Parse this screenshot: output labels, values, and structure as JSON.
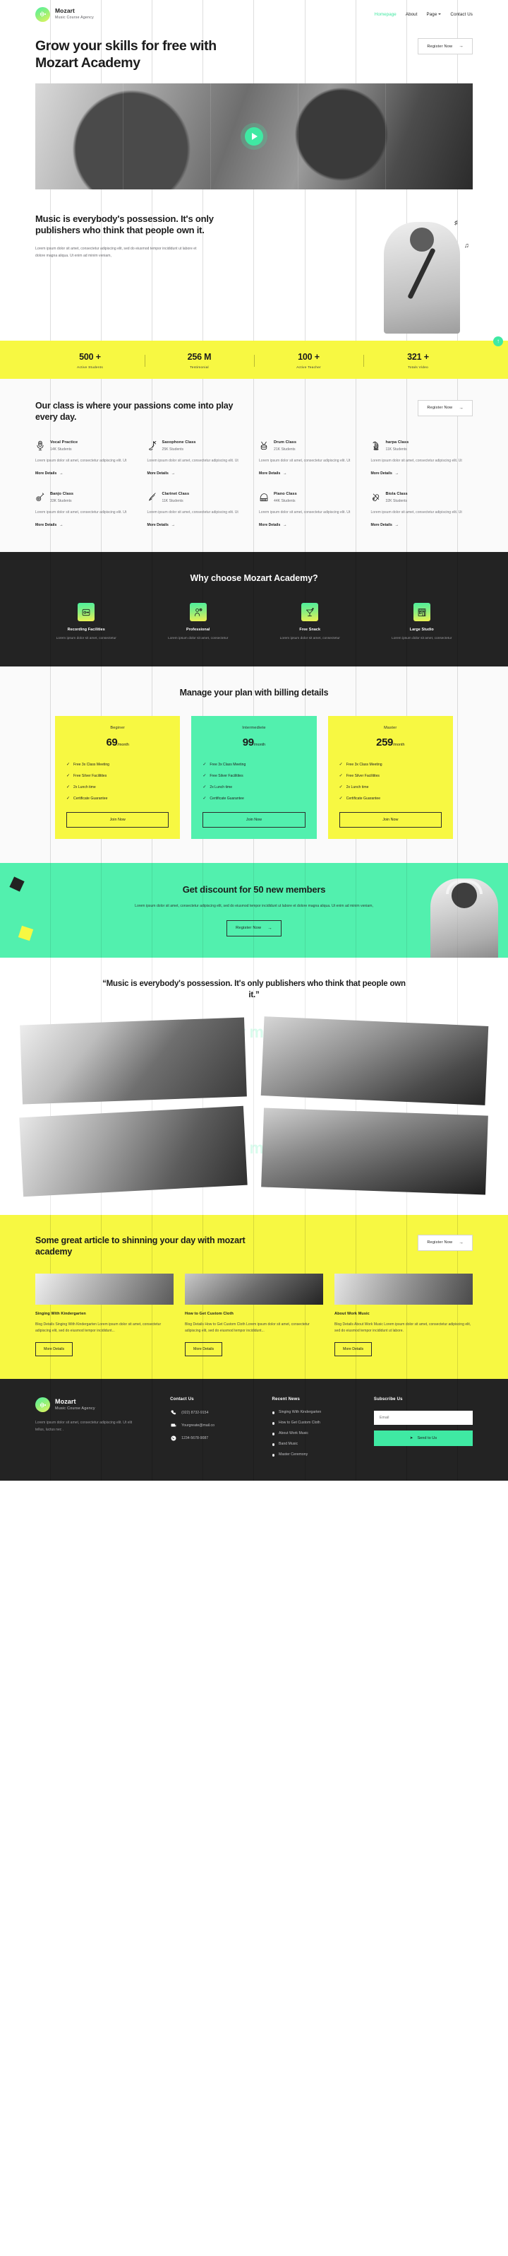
{
  "brand": {
    "name": "Mozart",
    "tagline": "Music Course Agency",
    "logo_icon": "music-wave-icon"
  },
  "nav": {
    "items": [
      {
        "label": "Homepage",
        "active": true
      },
      {
        "label": "About",
        "active": false
      },
      {
        "label": "Page",
        "active": false,
        "has_dropdown": true
      },
      {
        "label": "Contact Us",
        "active": false
      }
    ]
  },
  "hero": {
    "title": "Grow your skills for free with Mozart Academy",
    "cta": "Register Now",
    "play_icon": "play-icon"
  },
  "possession": {
    "heading": "Music is everybody's possession. It's only publishers who think that people own it.",
    "body": "Lorem ipsum dolor sit amet, consectetur adipiscing elit, sed do eiusmod tempor incididunt ut labore et dolore magna aliqua. Ut enim ad minim veniam,"
  },
  "stats": [
    {
      "value": "500 +",
      "label": "Active Students"
    },
    {
      "value": "256 M",
      "label": "Testimonial"
    },
    {
      "value": "100 +",
      "label": "Active Teacher"
    },
    {
      "value": "321 +",
      "label": "Totals Video"
    }
  ],
  "classes": {
    "heading": "Our class is where your passions come into play every day.",
    "cta": "Register Now",
    "more_label": "More Details",
    "items": [
      {
        "title": "Vocal Practice",
        "students": "14K Students",
        "desc": "Lorem ipsum dolor sit amet, consectetur adipiscing elit. Ut",
        "icon": "microphone-icon"
      },
      {
        "title": "Saxophone Class",
        "students": "25K Students",
        "desc": "Lorem ipsum dolor sit amet, consectetur adipiscing elit. Ut",
        "icon": "saxophone-icon"
      },
      {
        "title": "Drum Class",
        "students": "21K Students",
        "desc": "Lorem ipsum dolor sit amet, consectetur adipiscing elit. Ut",
        "icon": "drum-icon"
      },
      {
        "title": "harpa Class",
        "students": "11K Students",
        "desc": "Lorem ipsum dolor sit amet, consectetur adipiscing elit. Ut",
        "icon": "harp-icon"
      },
      {
        "title": "Banjo Class",
        "students": "33K Students",
        "desc": "Lorem ipsum dolor sit amet, consectetur adipiscing elit. Ut",
        "icon": "banjo-icon"
      },
      {
        "title": "Clarinet Class",
        "students": "11K Students",
        "desc": "Lorem ipsum dolor sit amet, consectetur adipiscing elit. Ut",
        "icon": "clarinet-icon"
      },
      {
        "title": "Piano Class",
        "students": "44K Students",
        "desc": "Lorem ipsum dolor sit amet, consectetur adipiscing elit. Ut",
        "icon": "piano-icon"
      },
      {
        "title": "Biola Class",
        "students": "32K Students",
        "desc": "Lorem ipsum dolor sit amet, consectetur adipiscing elit. Ut",
        "icon": "violin-icon"
      }
    ]
  },
  "why": {
    "heading": "Why choose Mozart Academy?",
    "items": [
      {
        "title": "Recording Facilities",
        "desc": "Lorem ipsum dolor sit amet, consectetur",
        "icon": "recorder-icon"
      },
      {
        "title": "Professional",
        "desc": "Lorem ipsum dolor sit amet, consectetur",
        "icon": "professional-icon"
      },
      {
        "title": "Free Snack",
        "desc": "Lorem ipsum dolor sit amet, consectetur",
        "icon": "cocktail-icon"
      },
      {
        "title": "Large Studio",
        "desc": "Lorem ipsum dolor sit amet, consectetur",
        "icon": "studio-building-icon"
      }
    ]
  },
  "pricing": {
    "heading": "Manage your plan with billing details",
    "join_label": "Join Now",
    "plans": [
      {
        "name": "Beginer",
        "price": "69",
        "period": "/month",
        "highlight": false,
        "features": [
          "Free 3x Class Meeting",
          "Free Silver Facilitites",
          "2x Lunch time",
          "Certificate Guarantee"
        ]
      },
      {
        "name": "Intermediete",
        "price": "99",
        "period": "/month",
        "highlight": true,
        "features": [
          "Free 3x Class Meeting",
          "Free Silver Facilitites",
          "2x Lunch time",
          "Certificate Guarantee"
        ]
      },
      {
        "name": "Master",
        "price": "259",
        "period": "/month",
        "highlight": false,
        "features": [
          "Free 3x Class Meeting",
          "Free Silver Facilitites",
          "2x Lunch time",
          "Certificate Guarantee"
        ]
      }
    ]
  },
  "discount": {
    "heading": "Get discount for 50 new members",
    "body": "Lorem ipsum dolor sit amet, consectetur adipiscing elit, sed do eiusmod tempor incididunt ut labore et dolore magna aliqua. Ut enim ad minim veniam,",
    "cta": "Register Now"
  },
  "gallery": {
    "heading": "“Music is everybody's possession. It's only publishers who think that people own it.”",
    "ghost_text": "Dream your magic studio."
  },
  "articles": {
    "heading": "Some great article to shinning your day with mozart academy",
    "cta": "Register Now",
    "more_label": "More Details",
    "items": [
      {
        "title": "Singing With Kindergarten",
        "desc": "Blog Details Singing With Kindergarten Lorem ipsum dolor sit amet, consectetur adipiscing elit, sed do eiusmod tempor incididunt..."
      },
      {
        "title": "How to Get Custom Cloth",
        "desc": "Blog Details How to Get Custom Cloth Lorem ipsum dolor sit amet, consectetur adipiscing elit, sed do eiusmod tempor incididunt..."
      },
      {
        "title": "About Work Music",
        "desc": "Blog Details About Work Music Lorem ipsum dolor sit amet, consectetur adipiscing elit, sed do eiusmod tempor incididunt ut labore."
      }
    ]
  },
  "footer": {
    "about": "Lorem ipsum dolor sit amet, consectetur adipiscing elit. Ut elit tellus, luctus nec .",
    "contact": {
      "heading": "Contact Us",
      "phone": "(022) 8732-9154",
      "email": "Yourgreate@mail.co",
      "whatsapp": "1234-5678-9087"
    },
    "recent": {
      "heading": "Recent News",
      "items": [
        "Singing With Kindergarten",
        "How to Get Custom Cloth",
        "About Work Music",
        "Band Music",
        "Master Ceremony"
      ]
    },
    "subscribe": {
      "heading": "Subscribe Us",
      "placeholder": "Email",
      "button": "Send to Us"
    }
  },
  "colors": {
    "yellow": "#f7f842",
    "green": "#52f0ae",
    "dark": "#232323",
    "accent": "#3fe9a3"
  }
}
